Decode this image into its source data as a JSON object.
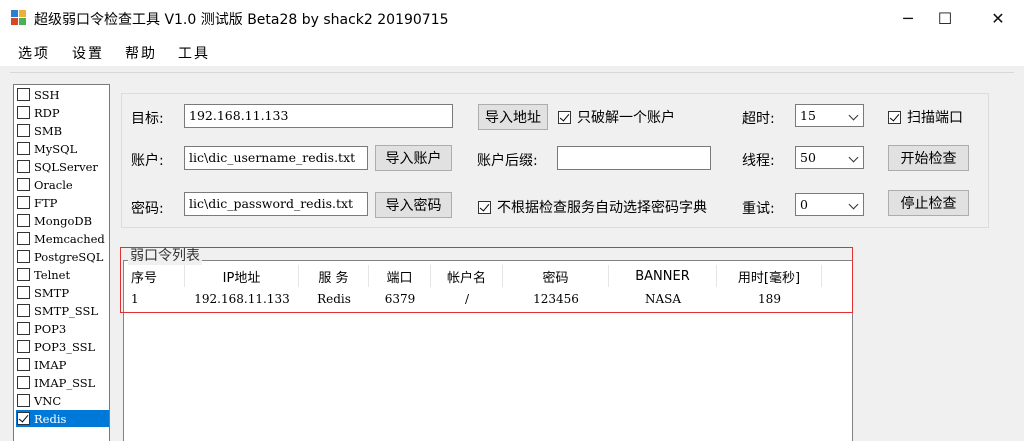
{
  "window": {
    "title": "超级弱口令检查工具 V1.0 测试版 Beta28 by shack2 20190715",
    "minimize_glyph": "─",
    "maximize_glyph": "☐",
    "close_glyph": "✕"
  },
  "menu": [
    "选项",
    "设置",
    "帮助",
    "工具"
  ],
  "services": [
    {
      "label": "SSH",
      "checked": false
    },
    {
      "label": "RDP",
      "checked": false
    },
    {
      "label": "SMB",
      "checked": false
    },
    {
      "label": "MySQL",
      "checked": false
    },
    {
      "label": "SQLServer",
      "checked": false
    },
    {
      "label": "Oracle",
      "checked": false
    },
    {
      "label": "FTP",
      "checked": false
    },
    {
      "label": "MongoDB",
      "checked": false
    },
    {
      "label": "Memcached",
      "checked": false
    },
    {
      "label": "PostgreSQL",
      "checked": false
    },
    {
      "label": "Telnet",
      "checked": false
    },
    {
      "label": "SMTP",
      "checked": false
    },
    {
      "label": "SMTP_SSL",
      "checked": false
    },
    {
      "label": "POP3",
      "checked": false
    },
    {
      "label": "POP3_SSL",
      "checked": false
    },
    {
      "label": "IMAP",
      "checked": false
    },
    {
      "label": "IMAP_SSL",
      "checked": false
    },
    {
      "label": "VNC",
      "checked": false
    },
    {
      "label": "Redis",
      "checked": true,
      "selected": true
    }
  ],
  "settings": {
    "target_label": "目标:",
    "target_value": "192.168.11.133",
    "import_target_btn": "导入地址",
    "crack_one_label": "只破解一个账户",
    "timeout_label": "超时:",
    "timeout_value": "15",
    "scan_port_label": "扫描端口",
    "account_label": "账户:",
    "account_value": "lic\\dic_username_redis.txt",
    "import_account_btn": "导入账户",
    "suffix_label": "账户后缀:",
    "suffix_value": "",
    "threads_label": "线程:",
    "threads_value": "50",
    "start_btn": "开始检查",
    "password_label": "密码:",
    "password_value": "lic\\dic_password_redis.txt",
    "import_password_btn": "导入密码",
    "no_auto_dict_label": "不根据检查服务自动选择密码字典",
    "retry_label": "重试:",
    "retry_value": "0",
    "stop_btn": "停止检查"
  },
  "results": {
    "caption": "弱口令列表",
    "headers": [
      "序号",
      "IP地址",
      "服 务",
      "端口",
      "帐户名",
      "密码",
      "BANNER",
      "用时[毫秒]"
    ],
    "rows": [
      [
        "1",
        "192.168.11.133",
        "Redis",
        "6379",
        "/",
        "123456",
        "NASA",
        "189"
      ]
    ]
  }
}
